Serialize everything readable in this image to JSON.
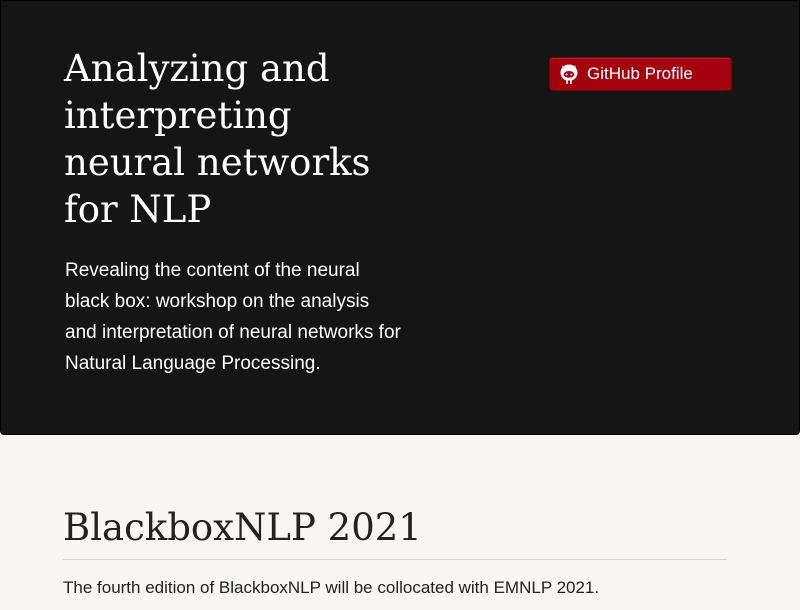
{
  "header": {
    "title": "Analyzing and interpreting neural networks for NLP",
    "tagline": "Revealing the content of the neural black box: workshop on the analysis and interpretation of neural networks for Natural Language Processing.",
    "github_button": {
      "label": "GitHub Profile",
      "icon": "github-octocat-icon"
    }
  },
  "main": {
    "heading": "BlackboxNLP 2021",
    "intro": "The fourth edition of BlackboxNLP will be collocated with EMNLP 2021."
  },
  "colors": {
    "header_bg": "#151515",
    "page_bg": "#f9f7f3",
    "button_bg": "#a4000e"
  }
}
